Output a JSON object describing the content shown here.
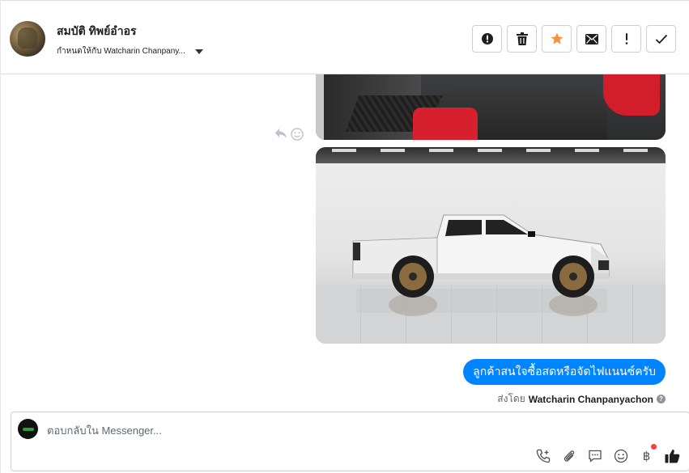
{
  "header": {
    "contact_name": "สมบัติ ทิพย์อำอร",
    "assigned_to": "กำหนดให้กับ Watcharin Chanpany...",
    "actions": [
      {
        "name": "spam-button",
        "icon": "alert-circle-icon"
      },
      {
        "name": "delete-button",
        "icon": "trash-icon"
      },
      {
        "name": "star-button",
        "icon": "star-icon"
      },
      {
        "name": "mark-unread-button",
        "icon": "envelope-icon"
      },
      {
        "name": "follow-up-button",
        "icon": "exclamation-icon"
      },
      {
        "name": "mark-done-button",
        "icon": "check-icon"
      }
    ],
    "star_color": "#f7923a"
  },
  "conversation": {
    "message_text": "ลูกค้าสนใจซื้อสดหรือจัดไฟแนนซ์ครับ",
    "sent_by_prefix": "ส่งโดย",
    "sent_by_name": "Watcharin Chanpanyachon",
    "help_glyph": "?",
    "bubble_color": "#0084ff"
  },
  "composer": {
    "placeholder": "ตอบกลับใน Messenger...",
    "currency_symbol": "฿",
    "tools": [
      "call-icon",
      "attach-icon",
      "saved-reply-icon",
      "emoji-icon",
      "payment-icon",
      "like-icon"
    ]
  }
}
